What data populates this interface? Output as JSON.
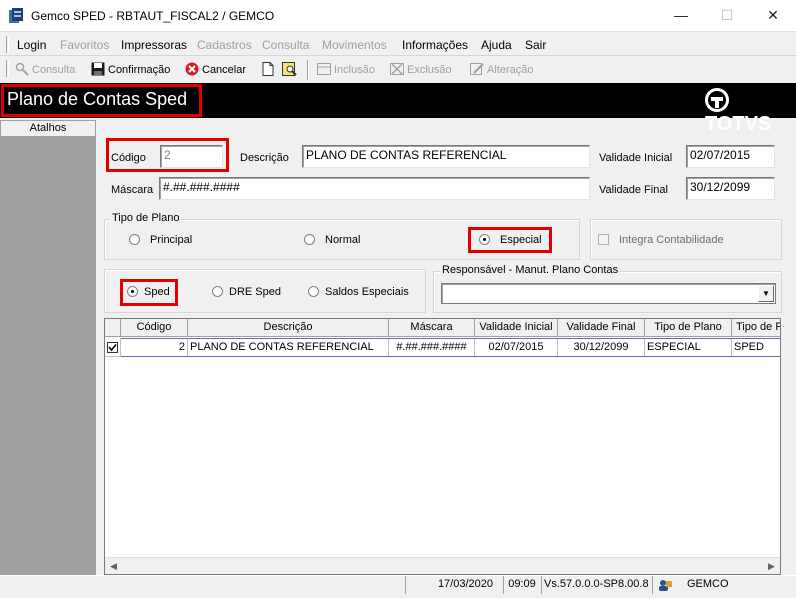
{
  "window": {
    "title": "Gemco SPED - RBTAUT_FISCAL2 / GEMCO",
    "minimize": "—",
    "maximize": "☐",
    "close": "✕"
  },
  "menu": [
    {
      "label": "Login",
      "enabled": true
    },
    {
      "label": "Favoritos",
      "enabled": false
    },
    {
      "label": "Impressoras",
      "enabled": true
    },
    {
      "label": "Cadastros",
      "enabled": false
    },
    {
      "label": "Consulta",
      "enabled": false
    },
    {
      "label": "Movimentos",
      "enabled": false
    },
    {
      "label": "Informações",
      "enabled": true
    },
    {
      "label": "Ajuda",
      "enabled": true
    },
    {
      "label": "Sair",
      "enabled": true
    }
  ],
  "toolbar": {
    "consulta": "Consulta",
    "confirmacao": "Confirmação",
    "cancelar": "Cancelar",
    "inclusao": "Inclusão",
    "exclusao": "Exclusão",
    "alteracao": "Alteração"
  },
  "page": {
    "title": "Plano de Contas Sped",
    "logo": "TOTVS"
  },
  "sidebar": {
    "header": "Atalhos"
  },
  "form": {
    "codigo_label": "Código",
    "codigo_value": "2",
    "descricao_label": "Descrição",
    "descricao_value": "PLANO DE CONTAS REFERENCIAL",
    "validade_inicial_label": "Validade Inicial",
    "validade_inicial_value": "02/07/2015",
    "mascara_label": "Máscara",
    "mascara_value": "#.##.###.####",
    "validade_final_label": "Validade Final",
    "validade_final_value": "30/12/2099",
    "tipo_plano_legend": "Tipo de Plano",
    "tipo_plano_options": [
      "Principal",
      "Normal",
      "Especial"
    ],
    "tipo_plano_selected": "Especial",
    "integra_label": "Integra Contabilidade",
    "sped_options": [
      "Sped",
      "DRE Sped",
      "Saldos Especiais"
    ],
    "sped_selected": "Sped",
    "responsavel_legend": "Responsável - Manut. Plano Contas",
    "responsavel_value": ""
  },
  "grid": {
    "columns": [
      "Código",
      "Descrição",
      "Máscara",
      "Validade Inicial",
      "Validade Final",
      "Tipo de Plano",
      "Tipo de P"
    ],
    "rows": [
      {
        "checked": true,
        "codigo": "2",
        "descricao": "PLANO DE CONTAS REFERENCIAL",
        "mascara": "#.##.###.####",
        "validade_inicial": "02/07/2015",
        "validade_final": "30/12/2099",
        "tipo_plano": "ESPECIAL",
        "tipo_p": "SPED"
      }
    ]
  },
  "status": {
    "date": "17/03/2020",
    "time": "09:09",
    "version": "Vs.57.0.0.0-SP8.00.8",
    "company": "GEMCO"
  },
  "colors": {
    "highlight": "#e00000",
    "header_bg": "#000000",
    "sidebar_bg": "#a0a0a0"
  }
}
